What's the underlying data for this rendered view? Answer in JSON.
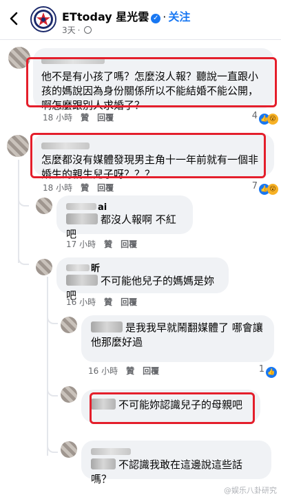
{
  "header": {
    "page_name": "ETtoday 星光雲",
    "follow_label": "关注",
    "separator": "·",
    "time": "3天",
    "verified_glyph": "✓"
  },
  "labels": {
    "like": "贊",
    "reply": "回覆"
  },
  "comments": [
    {
      "text": "他不是有小孩了嗎？怎麼沒人報？聽說一直跟小孩的媽說因為身份關係所以不能結婚不能公開，啊怎麼跟別人求婚了？",
      "time": "18 小時",
      "reaction_count": "4"
    },
    {
      "text": "怎麼都沒有媒體發現男主角十一年前就有一個非婚生的親生兒子呀？？？",
      "time": "18 小時",
      "reaction_count": "7",
      "replies": [
        {
          "name_suffix": "ai",
          "text": "都沒人報啊 不紅吧",
          "time": "17 小時"
        },
        {
          "name_suffix": "昕",
          "text": "不可能他兒子的媽媽是妳吧",
          "time": "16 小時"
        },
        {
          "text": "是我我早就鬧翻媒體了 哪會讓他那麼好過",
          "time": "16 小時",
          "reaction_count": "1"
        },
        {
          "text": "不可能妳認識兒子的母親吧"
        },
        {
          "text": "不認識我敢在這邊說這些話嗎？"
        }
      ]
    }
  ],
  "watermark": "@娱乐八卦研究",
  "icons": {
    "back": "chevron-left-icon",
    "like_reaction": "thumbs-up-icon",
    "wow_reaction": "wow-face-icon",
    "privacy": "globe-icon"
  },
  "colors": {
    "accent": "#1877f2",
    "highlight": "#e41e2b",
    "bubble": "#f0f2f5"
  }
}
